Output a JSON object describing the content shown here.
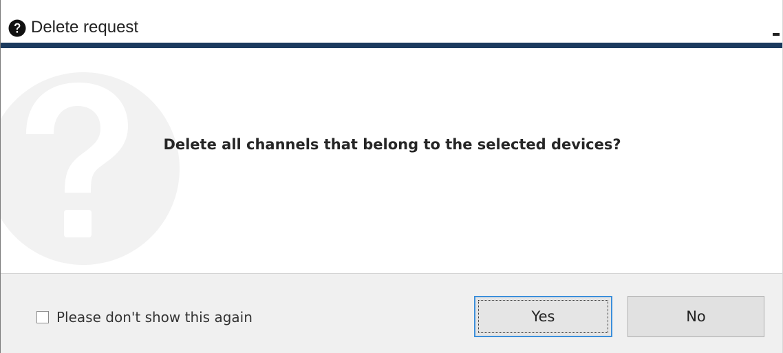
{
  "window": {
    "title": "Delete request",
    "title_icon": "question-circle-icon",
    "minimize_icon": "minimize-icon"
  },
  "content": {
    "message": "Delete all channels that belong to the selected devices?",
    "watermark_icon": "question-mark-icon"
  },
  "footer": {
    "checkbox_label": "Please don't show this again",
    "checkbox_checked": false,
    "yes_label": "Yes",
    "no_label": "No"
  },
  "colors": {
    "accent_bar": "#1b3a5e",
    "footer_bg": "#f0f0f0",
    "focus_border": "#3c8fdb",
    "button_bg": "#e1e1e1"
  }
}
